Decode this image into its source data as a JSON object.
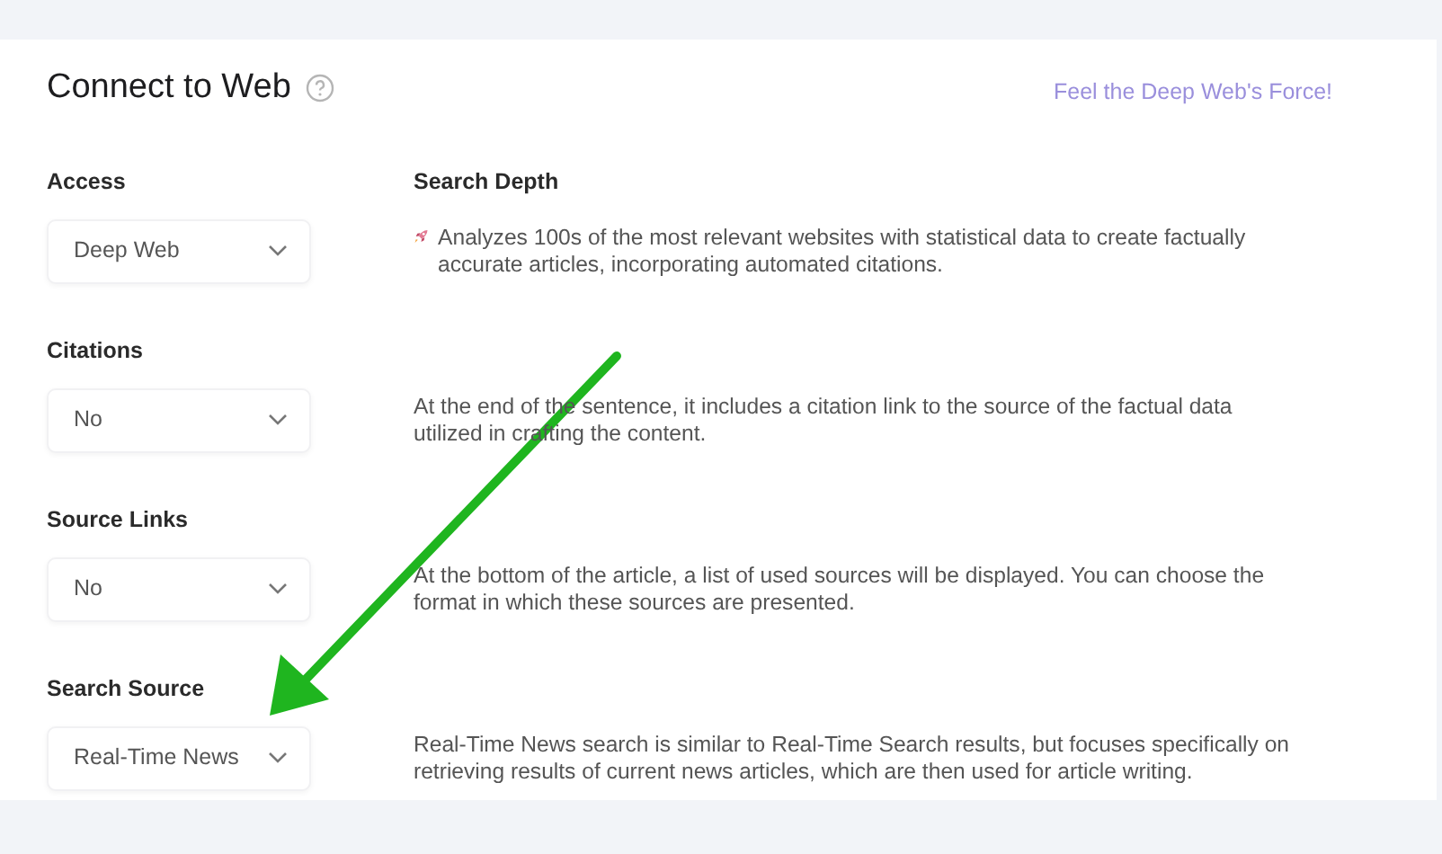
{
  "title": "Connect to Web",
  "promo_link": "Feel the Deep Web's Force!",
  "settings": [
    {
      "kind": "featured",
      "label": "Access",
      "value": "Deep Web",
      "heading": "Search Depth",
      "description": "Analyzes 100s of the most relevant websites with statistical data to create factually accurate articles, incorporating automated citations."
    },
    {
      "kind": "plain",
      "label": "Citations",
      "value": "No",
      "description": "At the end of the sentence, it includes a citation link to the source of the factual data utilized in crafting the content."
    },
    {
      "kind": "plain",
      "label": "Source Links",
      "value": "No",
      "description": "At the bottom of the article, a list of used sources will be displayed. You can choose the format in which these sources are presented."
    },
    {
      "kind": "plain",
      "label": "Search Source",
      "value": "Real-Time News",
      "description": "Real-Time News search is similar to Real-Time Search results, but focuses specifically on retrieving results of current news articles, which are then used for article writing."
    }
  ]
}
